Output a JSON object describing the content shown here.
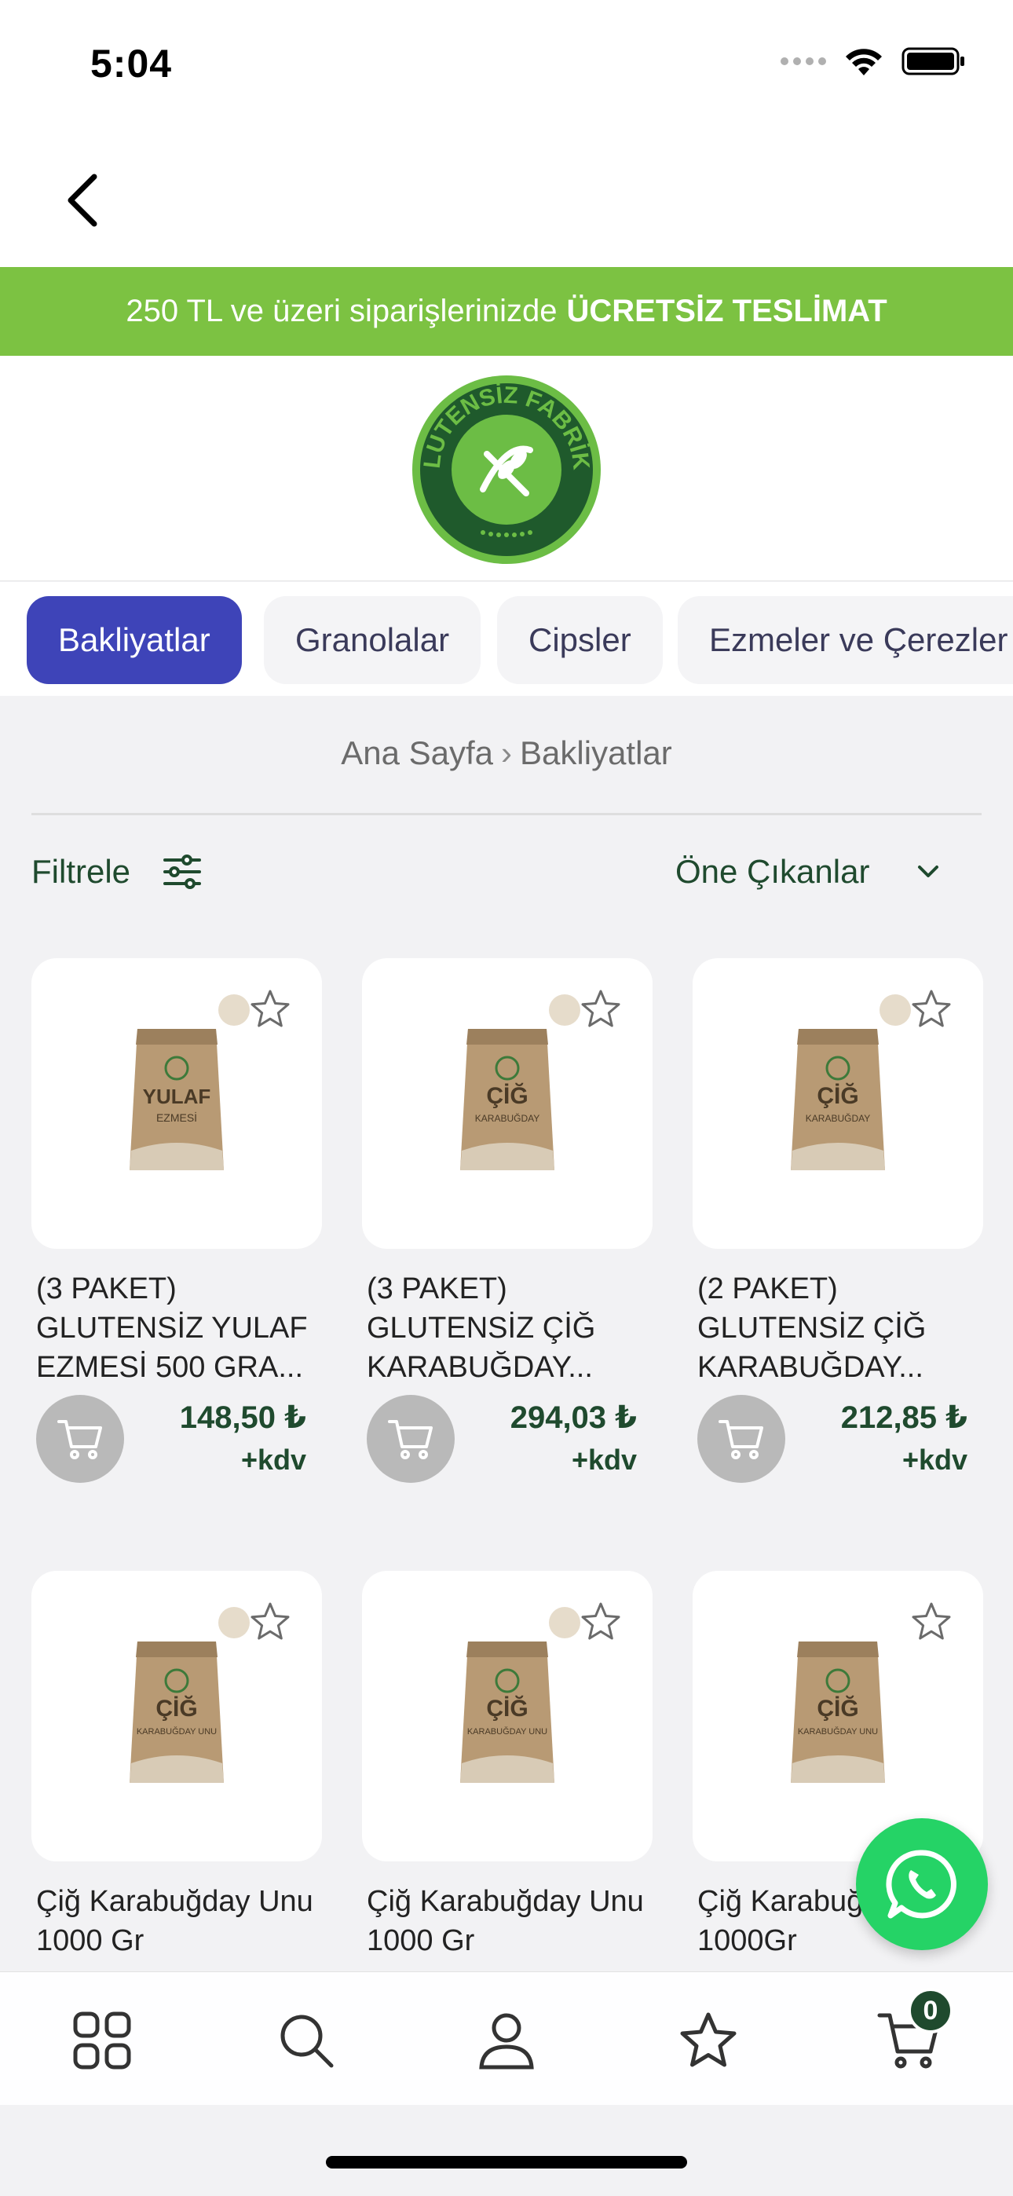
{
  "status_bar": {
    "time": "5:04"
  },
  "promo": {
    "text": "250 TL ve üzeri siparişlerinizde",
    "highlight": "ÜCRETSİZ TESLİMAT"
  },
  "logo": {
    "text": "GLUTENSİZ FABRİKA"
  },
  "categories": [
    {
      "label": "Bakliyatlar",
      "active": true
    },
    {
      "label": "Granolalar",
      "active": false
    },
    {
      "label": "Cipsler",
      "active": false
    },
    {
      "label": "Ezmeler ve Çerezler",
      "active": false
    }
  ],
  "breadcrumb": {
    "home": "Ana Sayfa",
    "current": "Bakliyatlar"
  },
  "toolbar": {
    "filter_label": "Filtrele",
    "sort_label": "Öne Çıkanlar"
  },
  "products": [
    {
      "name": "(3 PAKET) GLUTENSİZ YULAF EZMESİ 500 GRA...",
      "price": "148,50 ₺",
      "tax": "+kdv",
      "bag_title": "YULAF",
      "bag_sub": "EZMESİ"
    },
    {
      "name": "(3 PAKET) GLUTENSİZ ÇİĞ KARABUĞDAY...",
      "price": "294,03 ₺",
      "tax": "+kdv",
      "bag_title": "ÇİĞ",
      "bag_sub": "KARABUĞDAY"
    },
    {
      "name": "(2 PAKET) GLUTENSİZ ÇİĞ KARABUĞDAY...",
      "price": "212,85 ₺",
      "tax": "+kdv",
      "bag_title": "ÇİĞ",
      "bag_sub": "KARABUĞDAY"
    },
    {
      "name": "Çiğ Karabuğday Unu 1000 Gr",
      "price": "",
      "tax": "",
      "bag_title": "ÇİĞ",
      "bag_sub": "KARABUĞDAY UNU"
    },
    {
      "name": "Çiğ Karabuğday Unu 1000 Gr",
      "price": "",
      "tax": "",
      "bag_title": "ÇİĞ",
      "bag_sub": "KARABUĞDAY UNU"
    },
    {
      "name": "Çiğ Karabuğday Unu 1000Gr",
      "price": "",
      "tax": "",
      "bag_title": "ÇİĞ",
      "bag_sub": "KARABUĞDAY UNU"
    }
  ],
  "bottom_tabs": [
    {
      "name": "categories",
      "icon": "grid-icon"
    },
    {
      "name": "search",
      "icon": "search-icon"
    },
    {
      "name": "account",
      "icon": "user-icon"
    },
    {
      "name": "favorites",
      "icon": "star-icon"
    },
    {
      "name": "cart",
      "icon": "cart-icon",
      "badge": "0"
    }
  ],
  "colors": {
    "accent": "#3e44b8",
    "brand_green": "#7cc242",
    "price_green": "#1f4a2e",
    "whatsapp": "#25d366"
  }
}
